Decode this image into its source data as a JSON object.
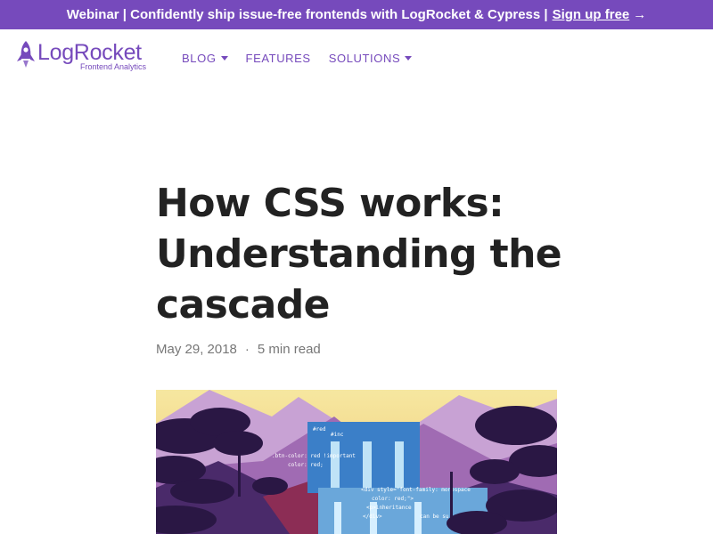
{
  "banner": {
    "text": "Webinar | Confidently ship issue-free frontends with LogRocket & Cypress |",
    "link": "Sign up free",
    "arrow": "→"
  },
  "logo": {
    "name": "LogRocket",
    "tagline": "Frontend Analytics",
    "icon": "rocket-icon"
  },
  "nav": {
    "items": [
      {
        "label": "BLOG",
        "has_dropdown": true
      },
      {
        "label": "FEATURES",
        "has_dropdown": false
      },
      {
        "label": "SOLUTIONS",
        "has_dropdown": true
      }
    ]
  },
  "article": {
    "title": "How CSS works: Understanding the cascade",
    "date": "May 29, 2018",
    "separator": "·",
    "read_time": "5 min read"
  },
  "hero": {
    "code_fragments": [
      "#red",
      "#inc",
      ".btn-color: red !important",
      "color: red;",
      "<div style=\"font-family: monospace",
      "color: red;\">",
      "<p>inheritance",
      "</div>",
      "can be su"
    ]
  },
  "colors": {
    "brand": "#764abc",
    "heading": "#222222",
    "meta": "#777777"
  }
}
